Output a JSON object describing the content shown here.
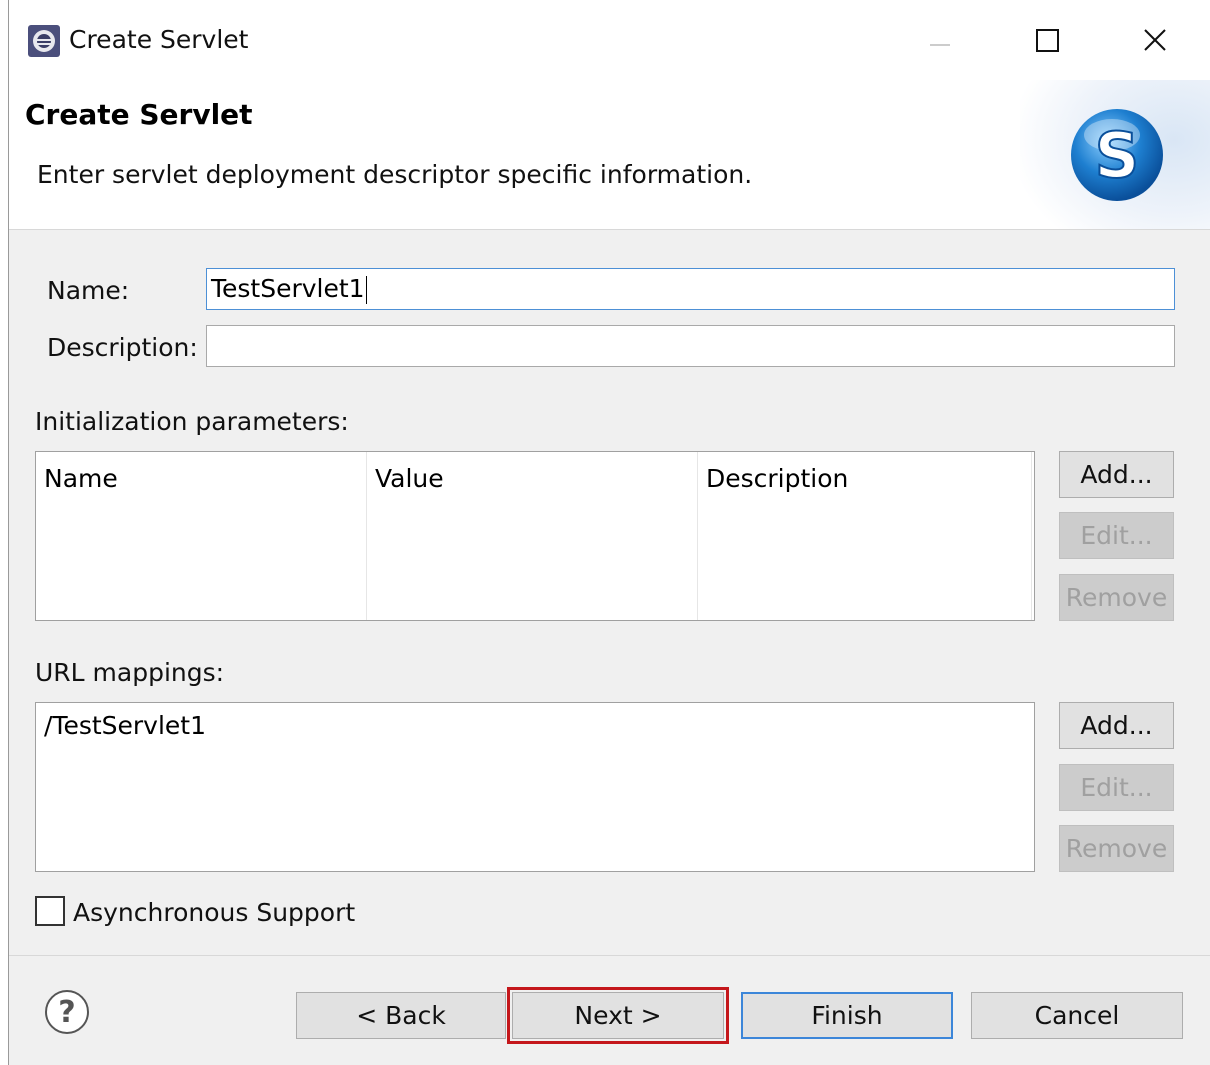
{
  "window": {
    "title": "Create Servlet"
  },
  "banner": {
    "title": "Create Servlet",
    "description": "Enter servlet deployment descriptor specific information.",
    "logo_letter": "S"
  },
  "form": {
    "name_label": "Name:",
    "name_value": "TestServlet1",
    "description_label": "Description:",
    "description_value": ""
  },
  "init_params": {
    "label": "Initialization parameters:",
    "columns": [
      "Name",
      "Value",
      "Description"
    ],
    "rows": [],
    "buttons": {
      "add": "Add...",
      "edit": "Edit...",
      "remove": "Remove"
    }
  },
  "url_mappings": {
    "label": "URL mappings:",
    "items": [
      "/TestServlet1"
    ],
    "buttons": {
      "add": "Add...",
      "edit": "Edit...",
      "remove": "Remove"
    }
  },
  "async": {
    "label": "Asynchronous Support",
    "checked": false
  },
  "footer": {
    "help_symbol": "?",
    "back": "< Back",
    "next": "Next >",
    "finish": "Finish",
    "cancel": "Cancel"
  },
  "colors": {
    "focus_border": "#4d90d6",
    "default_button_border": "#3c86d9",
    "highlight_outline": "#c4171b",
    "logo_blue": "#1e7fd0"
  }
}
